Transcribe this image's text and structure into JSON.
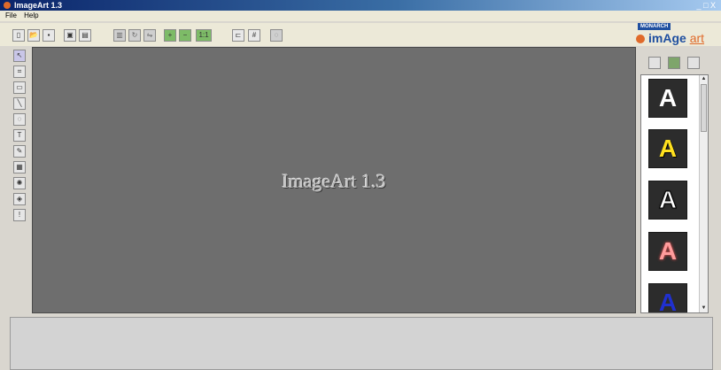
{
  "window": {
    "title": "ImageArt 1.3",
    "controls": "_ □ X"
  },
  "menu": {
    "items": [
      "File",
      "Help"
    ]
  },
  "toolbar": {
    "buttons": [
      {
        "name": "new-file-icon",
        "glyph": "▯"
      },
      {
        "name": "open-icon",
        "glyph": "📂"
      },
      {
        "name": "save-icon",
        "glyph": "▪"
      },
      {
        "name": "scan-icon",
        "glyph": "▣"
      },
      {
        "name": "image-icon",
        "glyph": "▤"
      },
      {
        "name": "layer-icon",
        "glyph": "▥"
      },
      {
        "name": "rotate-icon",
        "glyph": "↻"
      },
      {
        "name": "flip-icon",
        "glyph": "⇋"
      },
      {
        "name": "zoom-in-icon",
        "glyph": "+"
      },
      {
        "name": "zoom-out-icon",
        "glyph": "−"
      },
      {
        "name": "actual-size-label",
        "glyph": "1:1"
      },
      {
        "name": "align-icon",
        "glyph": "⊏"
      },
      {
        "name": "grid-icon",
        "glyph": "#"
      },
      {
        "name": "lock-icon",
        "glyph": "◌"
      }
    ]
  },
  "logo": {
    "badge": "MONARCH",
    "word_main": "imAge",
    "word_accent": "art"
  },
  "lefttools": [
    {
      "name": "select-tool-icon",
      "glyph": "↖"
    },
    {
      "name": "crop-tool-icon",
      "glyph": "⌗"
    },
    {
      "name": "rectangle-tool-icon",
      "glyph": "▭"
    },
    {
      "name": "line-tool-icon",
      "glyph": "╲"
    },
    {
      "name": "lasso-tool-icon",
      "glyph": "◌"
    },
    {
      "name": "text-tool-icon",
      "glyph": "T"
    },
    {
      "name": "brush-tool-icon",
      "glyph": "✎"
    },
    {
      "name": "picture-tool-icon",
      "glyph": "▦"
    },
    {
      "name": "effects-tool-icon",
      "glyph": "✺"
    },
    {
      "name": "fill-tool-icon",
      "glyph": "◈"
    },
    {
      "name": "info-tool-icon",
      "glyph": "!"
    }
  ],
  "canvas": {
    "watermark": "ImageArt 1.3"
  },
  "style_panel": {
    "swatch_letter": "A",
    "buttons": [
      "add-style-icon",
      "refresh-styles-icon",
      "remove-style-icon"
    ]
  }
}
